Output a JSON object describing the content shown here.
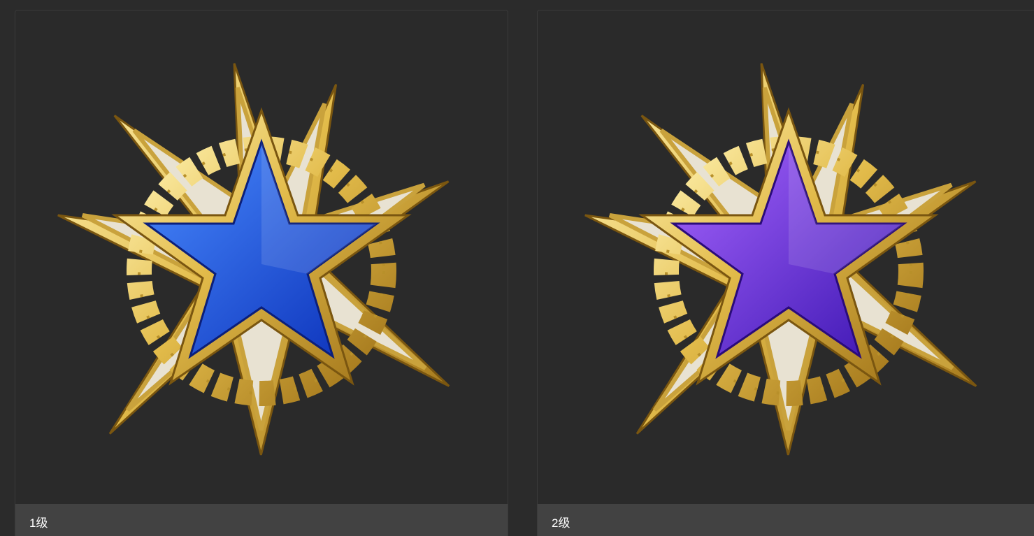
{
  "cards": [
    {
      "label": "1级",
      "gem_color_light": "#4a8cff",
      "gem_color_dark": "#0a2fb8",
      "icon": "medal-star-icon"
    },
    {
      "label": "2级",
      "gem_color_light": "#a866ff",
      "gem_color_dark": "#3a14b0",
      "icon": "medal-star-icon"
    }
  ],
  "colors": {
    "background": "#2b2b2b",
    "caption_bg": "#424242",
    "gold_light": "#f6e08a",
    "gold_dark": "#a87a1c",
    "enamel_white": "#e8e2d2"
  }
}
